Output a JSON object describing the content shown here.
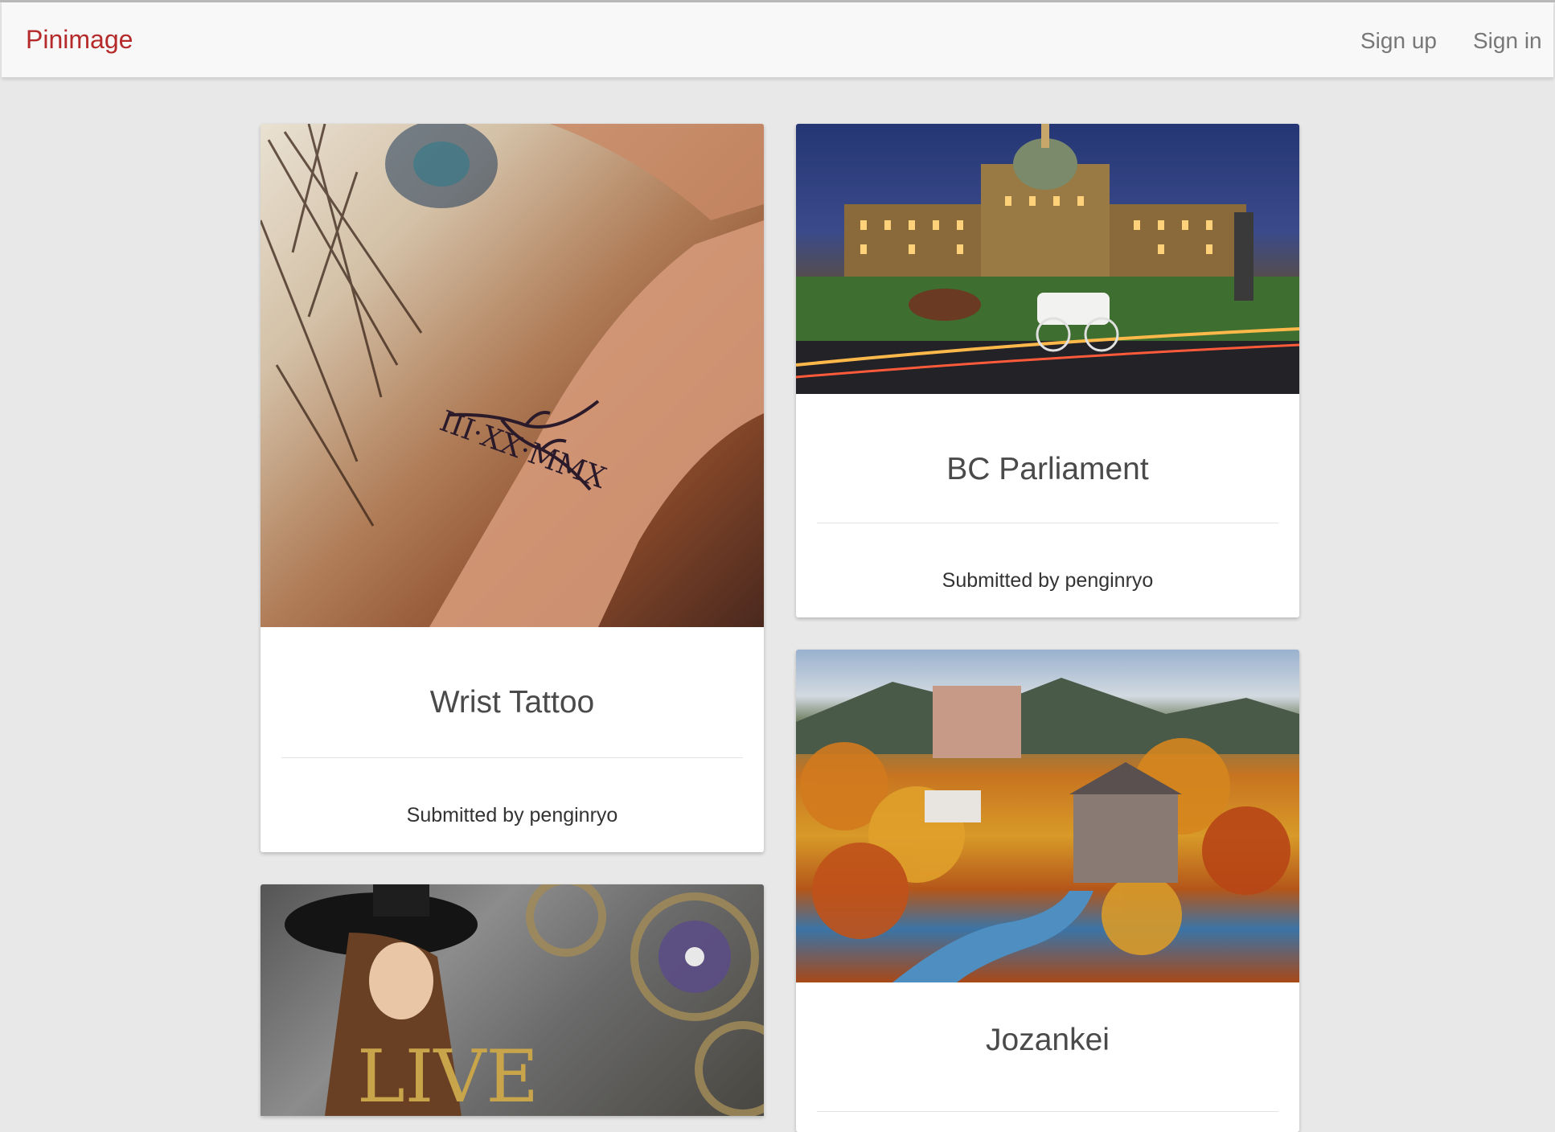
{
  "app": {
    "brand": "Pinimage",
    "colors": {
      "brand": "#b52a2a",
      "nav_text": "#777777",
      "background": "#e8e8e8"
    }
  },
  "nav": {
    "sign_up": "Sign up",
    "sign_in": "Sign in"
  },
  "cards": [
    {
      "title": "Wrist Tattoo",
      "submitted": "Submitted by penginryo",
      "image": "wrist-tattoo-photo",
      "image_text": "III·XX·MMX"
    },
    {
      "title": "BC Parliament",
      "submitted": "Submitted by penginryo",
      "image": "bc-parliament-photo"
    },
    {
      "title": "Jozankei",
      "submitted": "",
      "image": "jozankei-autumn-photo"
    },
    {
      "title": "",
      "submitted": "",
      "image": "live-album-cover-photo",
      "image_text": "LIVE"
    }
  ]
}
